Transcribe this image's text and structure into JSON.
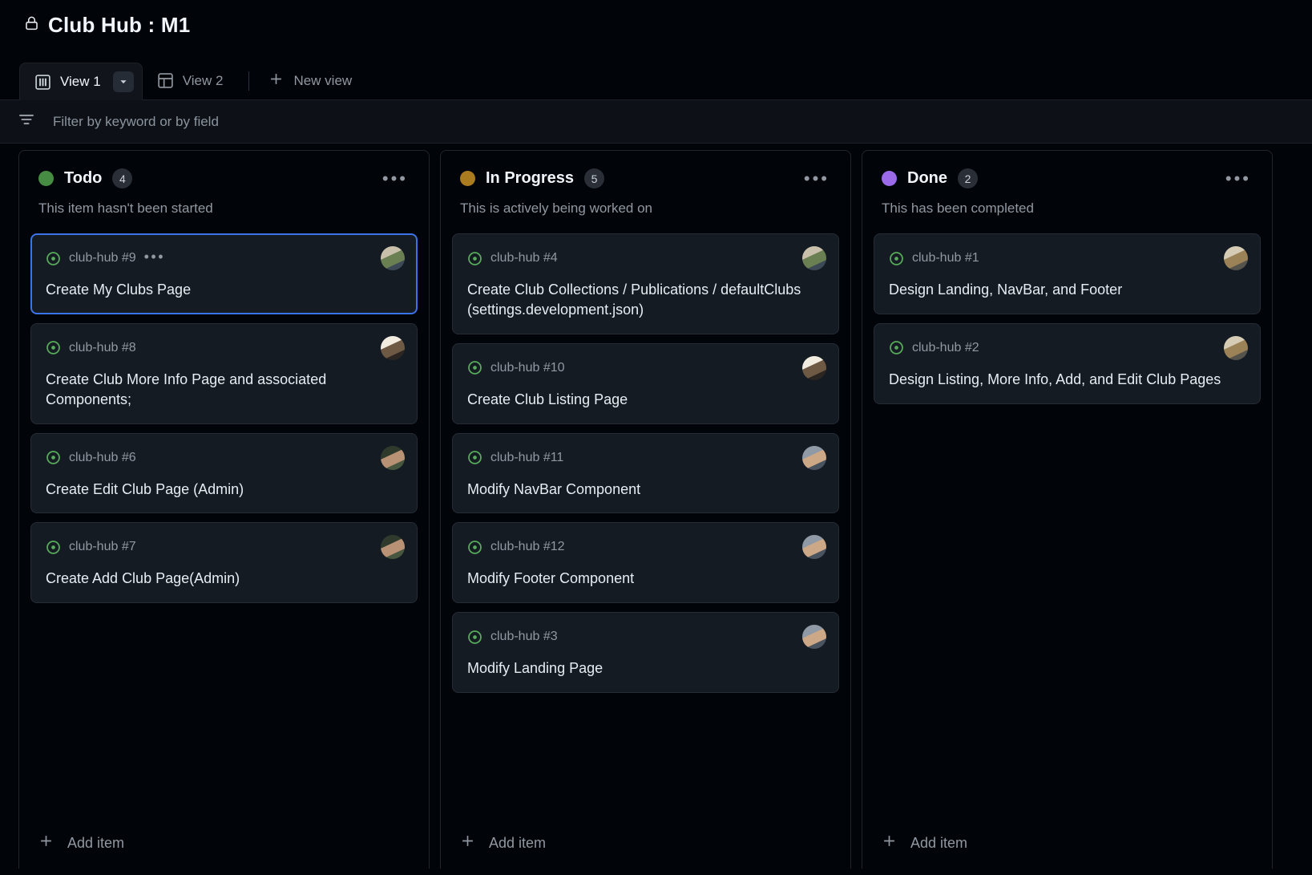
{
  "header": {
    "lock_icon": "lock-icon",
    "title": "Club Hub : M1"
  },
  "tabs": {
    "items": [
      {
        "label": "View 1",
        "icon": "board-view-icon",
        "active": true,
        "caret": "chevron-down-icon"
      },
      {
        "label": "View 2",
        "icon": "table-view-icon",
        "active": false
      }
    ],
    "new_view": {
      "label": "New view",
      "icon": "plus-icon"
    }
  },
  "filter": {
    "icon": "filter-icon",
    "placeholder": "Filter by keyword or by field",
    "value": ""
  },
  "columns": [
    {
      "name": "Todo",
      "count": "4",
      "color": "#478c43",
      "description": "This item hasn't been started",
      "menu_icon": "kebab-menu-icon",
      "add_item_label": "Add item",
      "cards": [
        {
          "ref": "club-hub #9",
          "title": "Create My Clubs Page",
          "status_icon": "open-issue-icon",
          "selected": true,
          "show_dots": true,
          "avatar": "avatar-c1",
          "avatar_colors": [
            "#c8c0ab",
            "#6a7f52",
            "#3b4a56"
          ]
        },
        {
          "ref": "club-hub #8",
          "title": "Create Club More Info Page and associated Components;",
          "status_icon": "open-issue-icon",
          "selected": false,
          "show_dots": false,
          "avatar": "avatar-c2",
          "avatar_colors": [
            "#f2ece0",
            "#6e5a44",
            "#2b2622"
          ]
        },
        {
          "ref": "club-hub #6",
          "title": "Create Edit Club Page (Admin)",
          "status_icon": "open-issue-icon",
          "selected": false,
          "show_dots": false,
          "avatar": "avatar-c3",
          "avatar_colors": [
            "#2f3a2c",
            "#b99276",
            "#46563f"
          ]
        },
        {
          "ref": "club-hub #7",
          "title": "Create Add Club Page(Admin)",
          "status_icon": "open-issue-icon",
          "selected": false,
          "show_dots": false,
          "avatar": "avatar-c4",
          "avatar_colors": [
            "#2f3a2c",
            "#b99276",
            "#46563f"
          ]
        }
      ]
    },
    {
      "name": "In Progress",
      "count": "5",
      "color": "#ab7b1f",
      "description": "This is actively being worked on",
      "menu_icon": "kebab-menu-icon",
      "add_item_label": "Add item",
      "cards": [
        {
          "ref": "club-hub #4",
          "title": "Create Club Collections / Publications / defaultClubs (settings.development.json)",
          "status_icon": "open-issue-icon",
          "selected": false,
          "show_dots": false,
          "avatar": "avatar-c5",
          "avatar_colors": [
            "#c8c0ab",
            "#6a7f52",
            "#3b4a56"
          ]
        },
        {
          "ref": "club-hub #10",
          "title": "Create Club Listing Page",
          "status_icon": "open-issue-icon",
          "selected": false,
          "show_dots": false,
          "avatar": "avatar-c6",
          "avatar_colors": [
            "#f2ece0",
            "#6e5a44",
            "#2b2622"
          ]
        },
        {
          "ref": "club-hub #11",
          "title": "Modify NavBar Component",
          "status_icon": "open-issue-icon",
          "selected": false,
          "show_dots": false,
          "avatar": "avatar-c7",
          "avatar_colors": [
            "#8f9aa6",
            "#cda887",
            "#4a5360"
          ]
        },
        {
          "ref": "club-hub #12",
          "title": "Modify Footer Component",
          "status_icon": "open-issue-icon",
          "selected": false,
          "show_dots": false,
          "avatar": "avatar-c8",
          "avatar_colors": [
            "#8f9aa6",
            "#cda887",
            "#4a5360"
          ]
        },
        {
          "ref": "club-hub #3",
          "title": "Modify Landing Page",
          "status_icon": "open-issue-icon",
          "selected": false,
          "show_dots": false,
          "avatar": "avatar-c9",
          "avatar_colors": [
            "#8f9aa6",
            "#cda887",
            "#4a5360"
          ]
        }
      ]
    },
    {
      "name": "Done",
      "count": "2",
      "color": "#9a6ae8",
      "description": "This has been completed",
      "menu_icon": "kebab-menu-icon",
      "add_item_label": "Add item",
      "cards": [
        {
          "ref": "club-hub #1",
          "title": "Design Landing, NavBar, and Footer",
          "status_icon": "open-issue-icon",
          "selected": false,
          "show_dots": false,
          "avatar": "avatar-c10",
          "avatar_colors": [
            "#d6cbb4",
            "#9c8257",
            "#55544c"
          ]
        },
        {
          "ref": "club-hub #2",
          "title": "Design Listing, More Info, Add, and Edit Club Pages",
          "status_icon": "open-issue-icon",
          "selected": false,
          "show_dots": false,
          "avatar": "avatar-c11",
          "avatar_colors": [
            "#d6cbb4",
            "#9c8257",
            "#55544c"
          ]
        }
      ]
    }
  ],
  "theme": {
    "accent": "#3b73e8",
    "page_bg": "#010409",
    "card_bg": "#151b23",
    "text": "#e6edf3",
    "muted": "#9198a1",
    "issue_green": "#57ab5a"
  }
}
